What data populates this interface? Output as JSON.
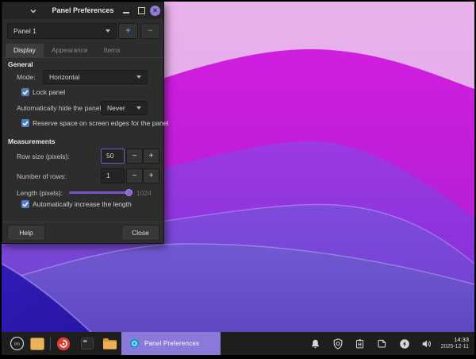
{
  "window": {
    "title": "Panel Preferences",
    "panel_selector": {
      "value": "Panel 1"
    },
    "tabs": [
      {
        "label": "Display"
      },
      {
        "label": "Appearance"
      },
      {
        "label": "Items"
      }
    ],
    "general": {
      "heading": "General",
      "mode_label": "Mode:",
      "mode_value": "Horizontal",
      "lock_panel_label": "Lock panel",
      "autohide_label": "Automatically hide the panel:",
      "autohide_value": "Never",
      "reserve_label": "Reserve space on screen edges for the panel"
    },
    "measurements": {
      "heading": "Measurements",
      "row_size_label": "Row size (pixels):",
      "row_size_value": "50",
      "num_rows_label": "Number of rows:",
      "num_rows_value": "1",
      "length_label": "Length (pixels):",
      "length_value": "1024",
      "auto_length_label": "Automatically increase the length"
    },
    "footer": {
      "help_label": "Help",
      "close_label": "Close"
    }
  },
  "taskbar": {
    "menu_glyph": "lm",
    "active_task_label": "Panel Preferences",
    "clock_time": "14:33",
    "clock_date": "2025-12-11"
  },
  "glyphs": {
    "add": "+",
    "remove": "−",
    "spin_minus": "−",
    "spin_plus": "+",
    "close_window": "×"
  },
  "colors": {
    "accent_purple": "#7a52c8",
    "accent_blue": "#4d7fc4",
    "task_highlight": "#8b79d9",
    "close_button": "#9678d8"
  }
}
